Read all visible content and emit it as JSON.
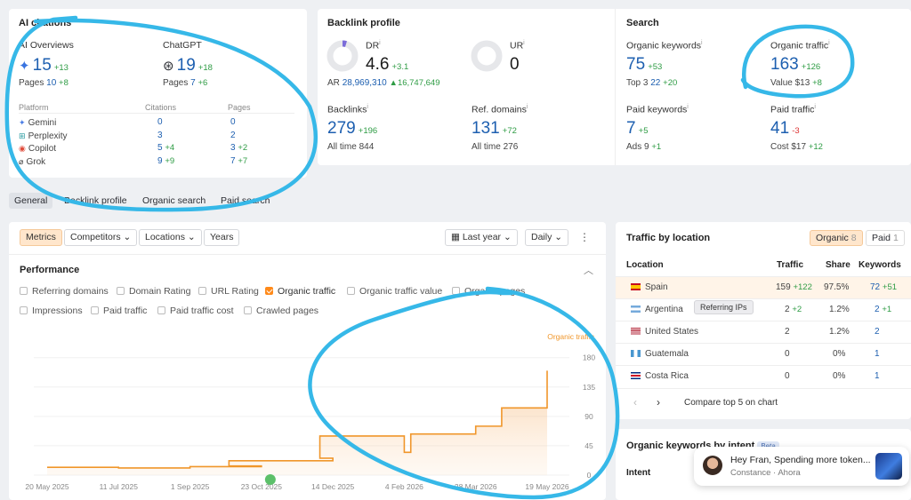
{
  "ai": {
    "title": "AI citations",
    "overviews": {
      "label": "AI Overviews",
      "value": "15",
      "delta": "+13",
      "pages_label": "Pages",
      "pages": "10",
      "pages_delta": "+8"
    },
    "chatgpt": {
      "label": "ChatGPT",
      "value": "19",
      "delta": "+18",
      "pages_label": "Pages",
      "pages": "7",
      "pages_delta": "+6"
    },
    "cols": [
      "Platform",
      "Citations",
      "Pages"
    ],
    "rows": [
      {
        "name": "Gemini",
        "cit": "0",
        "cit_d": "",
        "pages": "0",
        "pages_d": ""
      },
      {
        "name": "Perplexity",
        "cit": "3",
        "cit_d": "",
        "pages": "2",
        "pages_d": ""
      },
      {
        "name": "Copilot",
        "cit": "5",
        "cit_d": "+4",
        "pages": "3",
        "pages_d": "+2"
      },
      {
        "name": "Grok",
        "cit": "9",
        "cit_d": "+9",
        "pages": "7",
        "pages_d": "+7"
      }
    ]
  },
  "backlink": {
    "title": "Backlink profile",
    "dr": {
      "label": "DR",
      "value": "4.6",
      "delta": "+3.1",
      "progress": 0.046
    },
    "ur": {
      "label": "UR",
      "value": "0"
    },
    "ar": {
      "label": "AR",
      "value": "28,969,310",
      "delta": "16,747,649"
    },
    "backlinks": {
      "label": "Backlinks",
      "value": "279",
      "delta": "+196",
      "sub_label": "All time",
      "sub": "844"
    },
    "refdomains": {
      "label": "Ref. domains",
      "value": "131",
      "delta": "+72",
      "sub_label": "All time",
      "sub": "276"
    }
  },
  "search": {
    "title": "Search",
    "org_kw": {
      "label": "Organic keywords",
      "value": "75",
      "delta": "+53",
      "sub_label": "Top 3",
      "sub": "22",
      "sub_delta": "+20"
    },
    "org_tr": {
      "label": "Organic traffic",
      "value": "163",
      "delta": "+126",
      "sub_label": "Value",
      "sub": "$13",
      "sub_delta": "+8"
    },
    "paid_kw": {
      "label": "Paid keywords",
      "value": "7",
      "delta": "+5",
      "sub_label": "Ads",
      "sub": "9",
      "sub_delta": "+1"
    },
    "paid_tr": {
      "label": "Paid traffic",
      "value": "41",
      "delta": "-3",
      "sub_label": "Cost",
      "sub": "$17",
      "sub_delta": "+12"
    }
  },
  "tabs": [
    "General",
    "Backlink profile",
    "Organic search",
    "Paid search"
  ],
  "toolbar": {
    "metrics": "Metrics",
    "competitors": "Competitors",
    "locations": "Locations",
    "years": "Years",
    "range": "Last year",
    "interval": "Daily"
  },
  "performance": {
    "title": "Performance",
    "checks": [
      {
        "label": "Referring domains",
        "on": false
      },
      {
        "label": "Domain Rating",
        "on": false
      },
      {
        "label": "URL Rating",
        "on": false
      },
      {
        "label": "Organic traffic",
        "on": true
      },
      {
        "label": "Organic traffic value",
        "on": false
      },
      {
        "label": "Organic pages",
        "on": false
      },
      {
        "label": "Impressions",
        "on": false
      },
      {
        "label": "Paid traffic",
        "on": false
      },
      {
        "label": "Paid traffic cost",
        "on": false
      },
      {
        "label": "Crawled pages",
        "on": false
      }
    ]
  },
  "chart_data": {
    "type": "area",
    "series": [
      {
        "name": "Organic traffic",
        "color": "#f0962a"
      }
    ],
    "x_ticks": [
      "20 May 2025",
      "11 Jul 2025",
      "1 Sep 2025",
      "23 Oct 2025",
      "14 Dec 2025",
      "4 Feb 2026",
      "28 Mar 2026",
      "19 May 2026"
    ],
    "y_ticks": [
      "180",
      "135",
      "90",
      "45",
      "0"
    ],
    "ylim": [
      0,
      200
    ],
    "x": [
      "20 May 2025",
      "11 Jul 2025",
      "1 Sep 2025",
      "23 Oct 2025",
      "4 Nov 2025",
      "14 Dec 2025",
      "24 Dec 2025",
      "4 Feb 2026",
      "20 Feb 2026",
      "28 Mar 2026",
      "10 Apr 2026",
      "19 May 2026"
    ],
    "values": [
      12,
      11,
      13,
      14,
      22,
      26,
      60,
      35,
      63,
      75,
      103,
      160
    ]
  },
  "traffic": {
    "title": "Traffic by location",
    "organic_label": "Organic",
    "organic_count": "8",
    "paid_label": "Paid",
    "paid_count": "1",
    "cols": [
      "Location",
      "Traffic",
      "Share",
      "Keywords"
    ],
    "rows": [
      {
        "loc": "Spain",
        "traffic": "159",
        "t_d": "+122",
        "share": "97.5%",
        "kw": "72",
        "kw_d": "+51"
      },
      {
        "loc": "Argentina",
        "traffic": "2",
        "t_d": "+2",
        "share": "1.2%",
        "kw": "2",
        "kw_d": "+1"
      },
      {
        "loc": "United States",
        "traffic": "2",
        "t_d": "",
        "share": "1.2%",
        "kw": "2",
        "kw_d": ""
      },
      {
        "loc": "Guatemala",
        "traffic": "0",
        "t_d": "",
        "share": "0%",
        "kw": "1",
        "kw_d": ""
      },
      {
        "loc": "Costa Rica",
        "traffic": "0",
        "t_d": "",
        "share": "0%",
        "kw": "1",
        "kw_d": ""
      }
    ],
    "tooltip": "Referring IPs",
    "compare": "Compare top 5 on chart"
  },
  "intent": {
    "title": "Organic keywords by intent",
    "beta": "Beta",
    "col": "Intent"
  },
  "chat": {
    "message": "Hey Fran, Spending more token...",
    "sender": "Constance",
    "time": "Ahora"
  },
  "colors": {
    "accent": "#1d5fb0",
    "orange": "#ff8a1a",
    "annotation": "#36b8e8"
  }
}
